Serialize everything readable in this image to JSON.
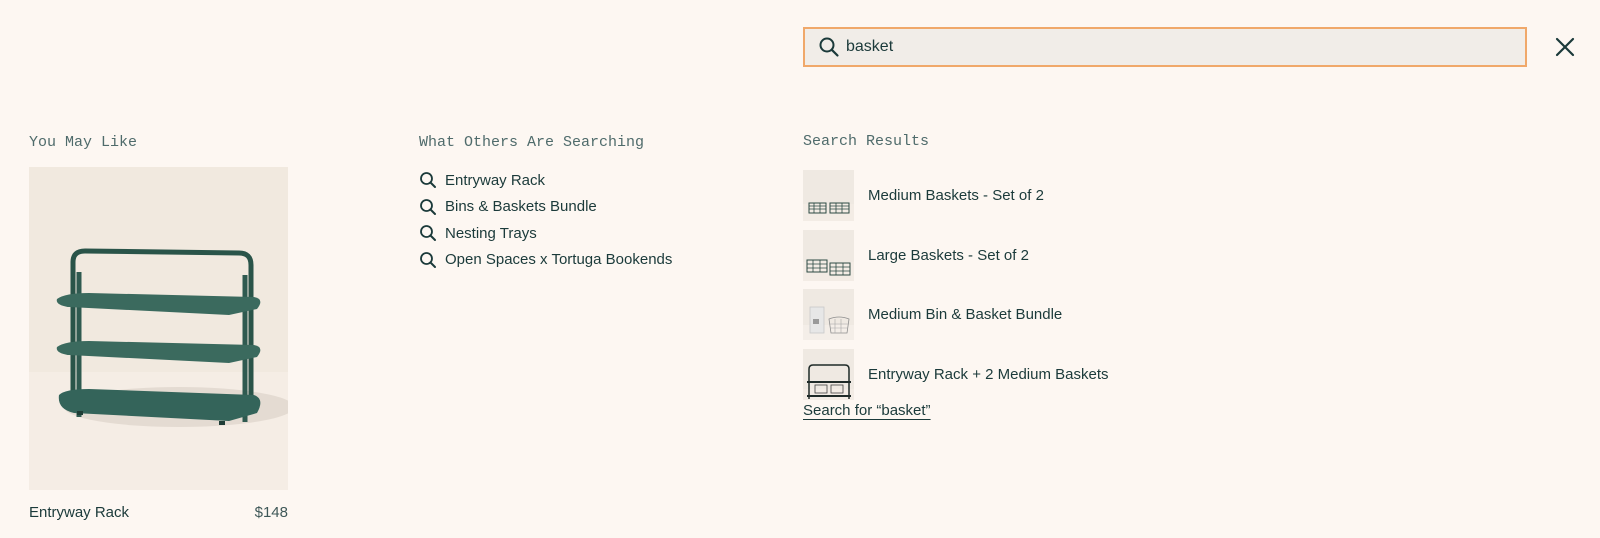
{
  "search": {
    "value": "basket",
    "icon": "search-icon"
  },
  "close": {
    "icon": "close-icon"
  },
  "you_may_like": {
    "heading": "You May Like",
    "product": {
      "name": "Entryway Rack",
      "price": "$148"
    }
  },
  "popular_searches": {
    "heading": "What Others Are Searching",
    "items": [
      {
        "label": "Entryway Rack"
      },
      {
        "label": "Bins & Baskets Bundle"
      },
      {
        "label": "Nesting Trays"
      },
      {
        "label": "Open Spaces x Tortuga Bookends"
      }
    ]
  },
  "search_results": {
    "heading": "Search Results",
    "items": [
      {
        "label": "Medium Baskets - Set of 2"
      },
      {
        "label": "Large Baskets - Set of 2"
      },
      {
        "label": "Medium Bin & Basket Bundle"
      },
      {
        "label": "Entryway Rack + 2 Medium Baskets"
      }
    ],
    "search_for_link": "Search for “basket”"
  },
  "colors": {
    "background": "#fdf7f2",
    "text": "#1b3a3a",
    "heading": "#4f6b6b",
    "search_border": "#f0a86a",
    "search_fill": "#f1ede8",
    "product_green": "#2f5a50"
  }
}
